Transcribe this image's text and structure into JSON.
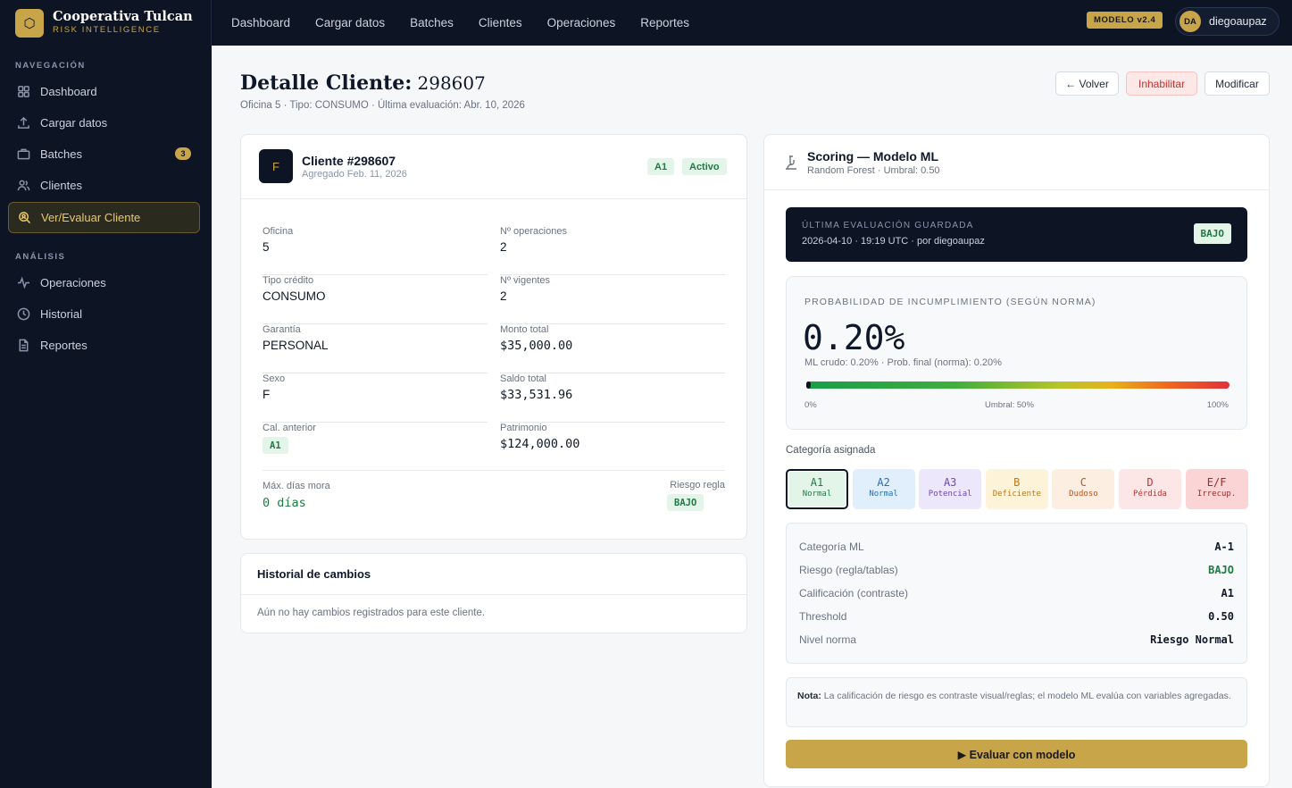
{
  "brand": {
    "name": "Cooperativa Tulcan",
    "subtitle": "RISK INTELLIGENCE",
    "logo_icon": "hexagon-icon"
  },
  "topnav": [
    "Dashboard",
    "Cargar datos",
    "Batches",
    "Clientes",
    "Operaciones",
    "Reportes"
  ],
  "model_badge": "MODELO v2.4",
  "user": {
    "initials": "DA",
    "name": "diegoaupaz"
  },
  "sidebar": {
    "section_nav": "NAVEGACIÓN",
    "section_analysis": "ANÁLISIS",
    "nav_items": [
      {
        "label": "Dashboard",
        "icon": "grid-icon"
      },
      {
        "label": "Cargar datos",
        "icon": "upload-icon"
      },
      {
        "label": "Batches",
        "icon": "briefcase-icon",
        "count": "3"
      },
      {
        "label": "Clientes",
        "icon": "users-icon"
      },
      {
        "label": "Ver/Evaluar Cliente",
        "icon": "search-user-icon",
        "active": true
      }
    ],
    "analysis_items": [
      {
        "label": "Operaciones",
        "icon": "activity-icon"
      },
      {
        "label": "Historial",
        "icon": "clock-icon"
      },
      {
        "label": "Reportes",
        "icon": "file-icon"
      }
    ]
  },
  "header": {
    "title_bold": "Detalle Cliente:",
    "title_id": "298607",
    "subtitle": "Oficina 5 · Tipo: CONSUMO · Última evaluación: Abr. 10, 2026",
    "back_label": "← Volver",
    "disable_label": "Inhabilitar",
    "modify_label": "Modificar"
  },
  "client_card": {
    "avatar": "F",
    "title": "Cliente #298607",
    "added": "Agregado Feb. 11, 2026",
    "tag_category": "A1",
    "tag_status": "Activo",
    "fields_left": [
      {
        "label": "Oficina",
        "value": "5"
      },
      {
        "label": "Tipo crédito",
        "value": "CONSUMO"
      },
      {
        "label": "Garantía",
        "value": "PERSONAL"
      },
      {
        "label": "Sexo",
        "value": "F"
      },
      {
        "label": "Cal. anterior",
        "value": "A1"
      }
    ],
    "fields_right": [
      {
        "label": "Nº operaciones",
        "value": "2"
      },
      {
        "label": "Nº vigentes",
        "value": "2"
      },
      {
        "label": "Monto total",
        "value": "$35,000.00"
      },
      {
        "label": "Saldo total",
        "value": "$33,531.96"
      },
      {
        "label": "Patrimonio",
        "value": "$124,000.00"
      }
    ],
    "max_mora_label": "Máx. días mora",
    "max_mora_value": "0 días",
    "risk_rule_label": "Riesgo regla",
    "risk_rule_value": "BAJO"
  },
  "history_card": {
    "title": "Historial de cambios",
    "empty": "Aún no hay cambios registrados para este cliente."
  },
  "scoring": {
    "title": "Scoring — Modelo ML",
    "subtitle": "Random Forest · Umbral: 0.50",
    "icon": "microscope-icon",
    "last_eval_label": "ÚLTIMA EVALUACIÓN GUARDADA",
    "last_eval_detail": "2026-04-10 · 19:19 UTC · por diegoaupaz",
    "last_eval_badge": "BAJO",
    "prob_label": "PROBABILIDAD DE INCUMPLIMIENTO (SEGÚN NORMA)",
    "prob_value": "0.20%",
    "prob_fraction": 0.002,
    "prob_detail": "ML crudo: 0.20% · Prob. final (norma): 0.20%",
    "scale_min": "0%",
    "scale_mid": "Umbral: 50%",
    "scale_max": "100%",
    "categories_label": "Categoría asignada",
    "categories": [
      {
        "code": "A1",
        "name": "Normal",
        "bg": "#e3f5e9",
        "fg": "#1f7a44",
        "selected": true
      },
      {
        "code": "A2",
        "name": "Normal",
        "bg": "#e1eefb",
        "fg": "#2b6cb0"
      },
      {
        "code": "A3",
        "name": "Potencial",
        "bg": "#ede7fb",
        "fg": "#6b46c1"
      },
      {
        "code": "B",
        "name": "Deficiente",
        "bg": "#fdf3d8",
        "fg": "#b7791f"
      },
      {
        "code": "C",
        "name": "Dudoso",
        "bg": "#fdeee2",
        "fg": "#c05621"
      },
      {
        "code": "D",
        "name": "Pérdida",
        "bg": "#fde6e6",
        "fg": "#c53030"
      },
      {
        "code": "E/F",
        "name": "Irrecup.",
        "bg": "#fbd5d5",
        "fg": "#9b2c2c"
      }
    ],
    "kv": [
      {
        "key": "Categoría ML",
        "value": "A-1",
        "color": "#111827"
      },
      {
        "key": "Riesgo (regla/tablas)",
        "value": "BAJO",
        "color": "#1f7a44"
      },
      {
        "key": "Calificación (contraste)",
        "value": "A1",
        "color": "#111827"
      },
      {
        "key": "Threshold",
        "value": "0.50",
        "color": "#111827"
      },
      {
        "key": "Nivel norma",
        "value": "Riesgo Normal",
        "color": "#111827"
      }
    ],
    "note_label": "Nota:",
    "note_text": "La calificación de riesgo es contraste visual/reglas; el modelo ML evalúa con variables agregadas.",
    "eval_button": "▶ Evaluar con modelo"
  },
  "colors": {
    "navy": "#0d1424",
    "gold": "#c9a54a",
    "green": "#1f7a44"
  }
}
